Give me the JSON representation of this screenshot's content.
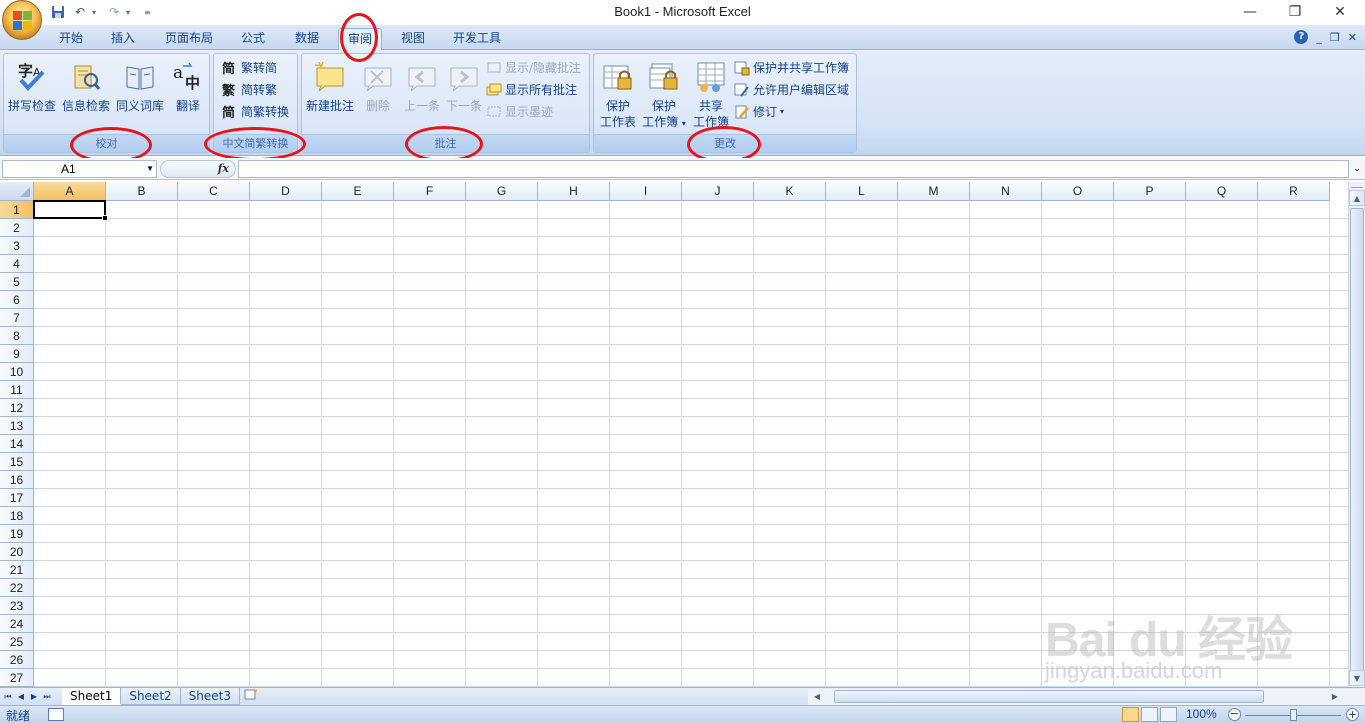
{
  "window": {
    "title": "Book1 - Microsoft Excel",
    "controls": [
      "—",
      "❐",
      "✕"
    ]
  },
  "tabs": [
    {
      "label": "开始",
      "active": false
    },
    {
      "label": "插入",
      "active": false
    },
    {
      "label": "页面布局",
      "active": false
    },
    {
      "label": "公式",
      "active": false
    },
    {
      "label": "数据",
      "active": false
    },
    {
      "label": "审阅",
      "active": true
    },
    {
      "label": "视图",
      "active": false
    },
    {
      "label": "开发工具",
      "active": false
    }
  ],
  "ribbon": {
    "proofing": {
      "label": "校对",
      "buttons": [
        "拼写检查",
        "信息检索",
        "同义词库",
        "翻译"
      ]
    },
    "chinese_conversion": {
      "label": "中文简繁转换",
      "buttons": [
        "繁转简",
        "简转繁",
        "简繁转换"
      ]
    },
    "comments": {
      "label": "批注",
      "buttons": [
        "新建批注",
        "删除",
        "上一条",
        "下一条"
      ],
      "small_buttons": [
        "显示/隐藏批注",
        "显示所有批注",
        "显示墨迹"
      ]
    },
    "changes": {
      "label": "更改",
      "protect_sheet": [
        "保护",
        "工作表"
      ],
      "protect_workbook": [
        "保护",
        "工作簿"
      ],
      "share_workbook": [
        "共享",
        "工作簿"
      ],
      "small_buttons": [
        "保护并共享工作簿",
        "允许用户编辑区域",
        "修订"
      ]
    }
  },
  "formula_bar": {
    "name_box": "A1",
    "fx": "fx",
    "value": ""
  },
  "grid": {
    "columns": [
      "A",
      "B",
      "C",
      "D",
      "E",
      "F",
      "G",
      "H",
      "I",
      "J",
      "K",
      "L",
      "M",
      "N",
      "O",
      "P",
      "Q",
      "R"
    ],
    "rows": [
      "1",
      "2",
      "3",
      "4",
      "5",
      "6",
      "7",
      "8",
      "9",
      "10",
      "11",
      "12",
      "13",
      "14",
      "15",
      "16",
      "17",
      "18",
      "19",
      "20",
      "21",
      "22",
      "23",
      "24",
      "25",
      "26",
      "27"
    ],
    "active_cell": "A1"
  },
  "sheets": [
    {
      "label": "Sheet1",
      "active": true
    },
    {
      "label": "Sheet2",
      "active": false
    },
    {
      "label": "Sheet3",
      "active": false
    }
  ],
  "status": {
    "text": "就绪",
    "zoom": "100%",
    "zoom_minus": "−",
    "zoom_plus": "+"
  },
  "watermark": {
    "brand": "Bai du 经验",
    "url": "jingyan.baidu.com"
  },
  "colors": {
    "ribbon_text": "#15428b",
    "annotation": "#e8141c",
    "grid_line": "#d0d7e5"
  }
}
